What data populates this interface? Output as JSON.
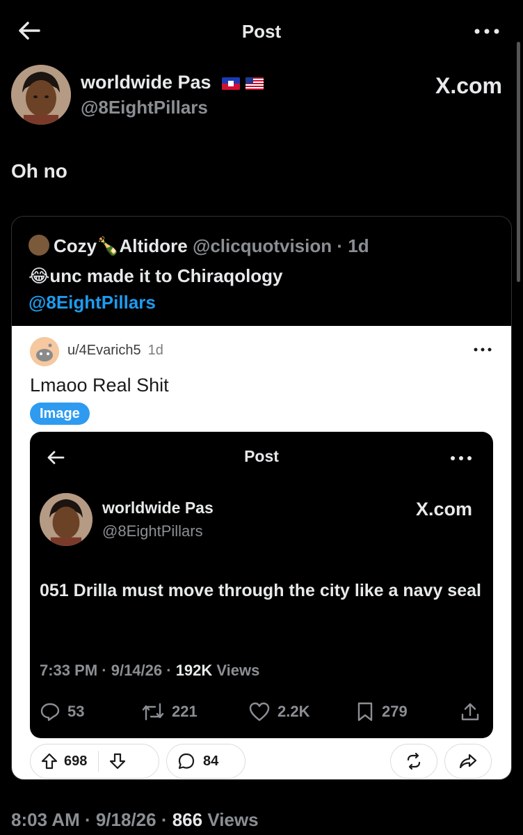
{
  "header": {
    "title": "Post"
  },
  "author": {
    "name": "worldwide Pas",
    "handle": "@8EightPillars",
    "flag1": "haitian-flag",
    "flag2": "us-flag",
    "source": "X.com"
  },
  "post": {
    "text": "Oh no"
  },
  "quote": {
    "name_part1": "Cozy",
    "name_emoji": "🍾",
    "name_part2": "Altidore",
    "handle": "@clicquotvision",
    "time": "1d",
    "text": "unc made it to Chiraqology",
    "text_emoji": "😂",
    "mention": "@8EightPillars"
  },
  "reddit": {
    "user": "u/4Evarich5",
    "time": "1d",
    "title": "Lmaoo Real Shit",
    "badge": "Image",
    "upvotes": "698",
    "comments": "84"
  },
  "inner_post": {
    "title": "Post",
    "name": "worldwide Pas",
    "handle": "@8EightPillars",
    "source": "X.com",
    "text": "051 Drilla must move through the city like a navy seal",
    "time": "7:33 PM",
    "date": "9/14/26",
    "views": "192K",
    "views_label": "Views",
    "replies": "53",
    "reposts": "221",
    "likes": "2.2K",
    "bookmarks": "279"
  },
  "footer": {
    "time": "8:03 AM",
    "date": "9/18/26",
    "views": "866",
    "views_label": "Views"
  },
  "colors": {
    "background": "#000000",
    "text": "#e7e9ea",
    "muted": "#8b8f94",
    "link": "#1d9bf0",
    "badge": "#2e9bf0"
  }
}
